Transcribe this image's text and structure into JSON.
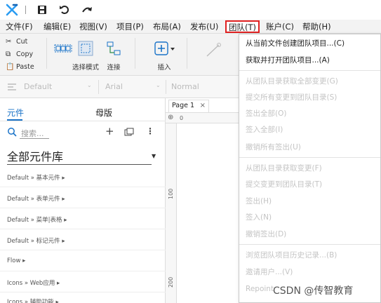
{
  "menubar": {
    "items": [
      "文件(F)",
      "编辑(E)",
      "视图(V)",
      "项目(P)",
      "布局(A)",
      "发布(U)",
      "团队(T)",
      "账户(C)",
      "帮助(H)"
    ],
    "active_index": 6
  },
  "toolbar": {
    "cut": "Cut",
    "copy": "Copy",
    "paste": "Paste",
    "select_mode": "选择模式",
    "connect": "连接",
    "insert": "插入"
  },
  "formatbar": {
    "style": "Default",
    "font": "Arial",
    "weight": "Normal"
  },
  "left_panel": {
    "tabs": [
      "元件",
      "母版"
    ],
    "search_placeholder": "搜索...",
    "library_title": "全部元件库",
    "libraries": [
      "Default » 基本元件 ▸",
      "Default » 表单元件 ▸",
      "Default » 菜单|表格 ▸",
      "Default » 标记元件 ▸",
      "Flow ▸",
      "Icons » Web应用 ▸",
      "Icons » 辅助功能 ▸"
    ]
  },
  "canvas": {
    "page_tab": "Page 1",
    "ruler_top": [
      "0"
    ],
    "ruler_left": [
      "100",
      "200"
    ]
  },
  "team_menu": {
    "groups": [
      [
        {
          "label": "从当前文件创建团队项目...(C)",
          "enabled": true
        },
        {
          "label": "获取并打开团队项目...(A)",
          "enabled": true
        }
      ],
      [
        {
          "label": "从团队目录获取全部变更(G)",
          "enabled": false
        },
        {
          "label": "提交所有变更到团队目录(S)",
          "enabled": false
        },
        {
          "label": "签出全部(O)",
          "enabled": false
        },
        {
          "label": "签入全部(I)",
          "enabled": false
        },
        {
          "label": "撤销所有签出(U)",
          "enabled": false
        }
      ],
      [
        {
          "label": "从团队目录获取变更(F)",
          "enabled": false
        },
        {
          "label": "提交变更到团队目录(T)",
          "enabled": false
        },
        {
          "label": "签出(H)",
          "enabled": false
        },
        {
          "label": "签入(N)",
          "enabled": false
        },
        {
          "label": "撤销签出(D)",
          "enabled": false
        }
      ],
      [
        {
          "label": "浏览团队项目历史记录...(B)",
          "enabled": false
        },
        {
          "label": "邀请用户...(V)",
          "enabled": false
        },
        {
          "label": "Repoint",
          "enabled": false
        }
      ]
    ]
  },
  "watermark": "CSDN @传智教育",
  "colors": {
    "accent": "#1a73c8",
    "highlight_border": "#e02020",
    "disabled_text": "#c4c4c4",
    "logo": "#2b9cf2"
  }
}
